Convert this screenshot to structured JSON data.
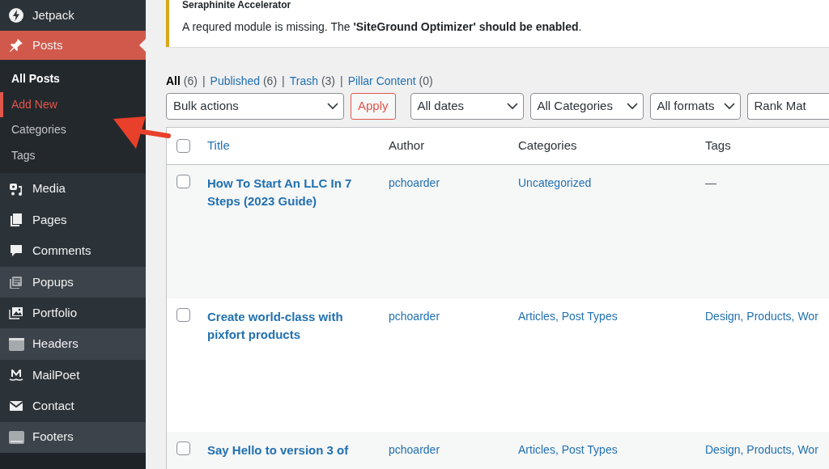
{
  "sidebar": {
    "items": [
      {
        "label": "Jetpack",
        "selected": false,
        "highlighted": false
      },
      {
        "label": "Posts",
        "selected": true,
        "highlighted": false,
        "children": [
          {
            "label": "All Posts",
            "selected": true,
            "highlighted": false
          },
          {
            "label": "Add New",
            "selected": false,
            "highlighted": true
          },
          {
            "label": "Categories",
            "selected": false,
            "highlighted": false
          },
          {
            "label": "Tags",
            "selected": false,
            "highlighted": false
          }
        ]
      },
      {
        "label": "Media",
        "selected": false,
        "highlighted": false
      },
      {
        "label": "Pages",
        "selected": false,
        "highlighted": false
      },
      {
        "label": "Comments",
        "selected": false,
        "highlighted": false
      },
      {
        "label": "Popups",
        "selected": false,
        "highlighted": true
      },
      {
        "label": "Portfolio",
        "selected": false,
        "highlighted": false
      },
      {
        "label": "Headers",
        "selected": false,
        "highlighted": true
      },
      {
        "label": "MailPoet",
        "selected": false,
        "highlighted": false
      },
      {
        "label": "Contact",
        "selected": false,
        "highlighted": false
      },
      {
        "label": "Footers",
        "selected": false,
        "highlighted": true
      }
    ]
  },
  "notice": {
    "title": "Seraphinite Accelerator",
    "message": "A requred module is missing. The **'SiteGround Optimizer' should be enabled**."
  },
  "status_links": [
    {
      "label": "All",
      "count": "(6)",
      "selected": true,
      "separator": "|"
    },
    {
      "label": "Published",
      "count": "(6)",
      "selected": false,
      "separator": "|"
    },
    {
      "label": "Trash",
      "count": "(3)",
      "selected": false,
      "separator": "|"
    },
    {
      "label": "Pillar Content",
      "count": "(0)",
      "selected": false
    }
  ],
  "filters": [
    {
      "kind": "select",
      "label": "Bulk actions"
    },
    {
      "kind": "button",
      "label": "Apply"
    },
    {
      "kind": "select",
      "label": "All dates"
    },
    {
      "kind": "select",
      "label": "All Categories"
    },
    {
      "kind": "select",
      "label": "All formats"
    },
    {
      "kind": "cut",
      "label": "Rank Mat"
    }
  ],
  "table": {
    "select_all_checked": false,
    "columns": [
      "Title",
      "Author",
      "Categories",
      "Tags"
    ],
    "rows": [
      {
        "checked": false,
        "title": "How To Start An LLC In 7 Steps (2023 Guide)",
        "author": "pchoarder",
        "categories": "Uncategorized",
        "tags": "—",
        "tags_empty": true
      },
      {
        "checked": false,
        "title": "Create world-class with pixfort products",
        "author": "pchoarder",
        "categories": "Articles, Post Types",
        "tags": "Design, Products, Wor",
        "tags_empty": false
      },
      {
        "checked": false,
        "title": "Say Hello to version 3 of",
        "author": "pchoarder",
        "categories": "Articles, Post Types",
        "tags": "Design, Products, Wor",
        "tags_empty": false
      }
    ]
  }
}
